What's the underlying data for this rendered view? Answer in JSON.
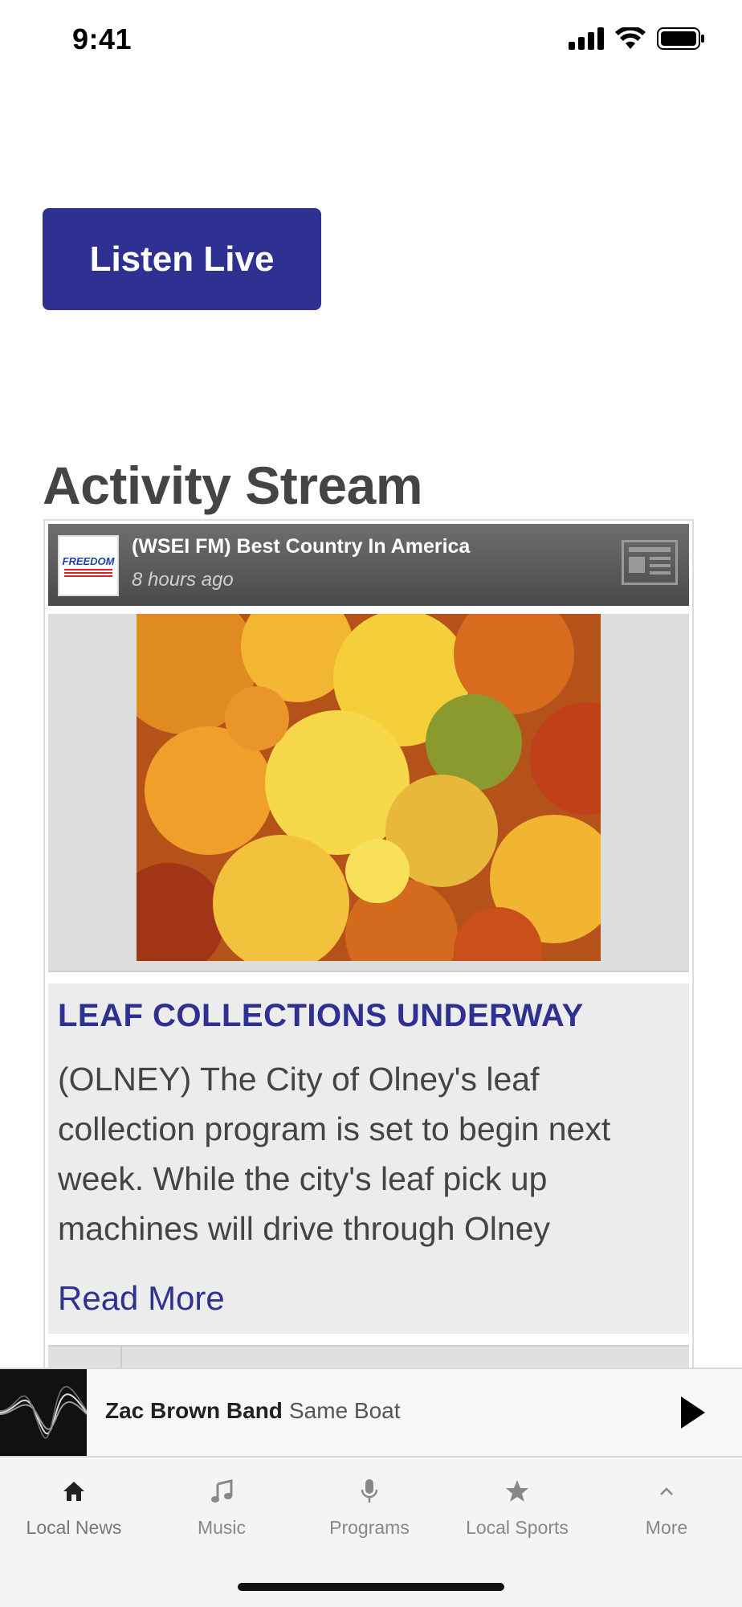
{
  "status_bar": {
    "time": "9:41"
  },
  "listen_live": {
    "label": "Listen Live"
  },
  "activity_stream": {
    "title": "Activity Stream",
    "post": {
      "station_name": "(WSEI FM) Best Country In America",
      "time_ago": "8 hours ago",
      "logo_text": "FREEDOM",
      "headline": "LEAF COLLECTIONS UNDERWAY",
      "excerpt": "(OLNEY) The City of Olney's leaf collection program is set to begin next week. While the city's leaf pick up machines will drive through Olney",
      "read_more": "Read More"
    }
  },
  "now_playing": {
    "artist": "Zac Brown Band",
    "song": "Same Boat"
  },
  "tabs": [
    {
      "label": "Local News",
      "icon": "home-icon"
    },
    {
      "label": "Music",
      "icon": "music-note-icon"
    },
    {
      "label": "Programs",
      "icon": "microphone-icon"
    },
    {
      "label": "Local Sports",
      "icon": "star-icon"
    },
    {
      "label": "More",
      "icon": "chevron-up-icon"
    }
  ],
  "colors": {
    "accent": "#2e3192",
    "header": "#5a5a5a",
    "card_bg": "#ececec"
  }
}
